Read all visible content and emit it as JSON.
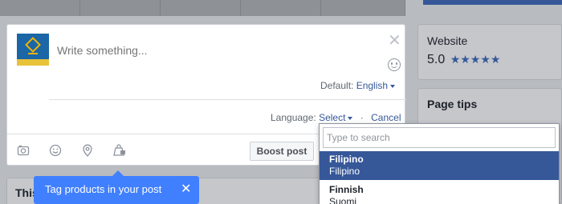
{
  "sidebar": {
    "website_title": "Website",
    "rating_value": "5.0",
    "rating_stars": "★★★★★",
    "page_tips_title": "Page tips"
  },
  "background": {
    "section_title_fragment": "This"
  },
  "composer": {
    "placeholder": "Write something...",
    "close_symbol": "✕",
    "default_label": "Default:",
    "default_value": "English",
    "language_label": "Language:",
    "language_select": "Select",
    "separator": "·",
    "cancel_label": "Cancel",
    "boost_label": "Boost post"
  },
  "footer_icons": [
    "camera-icon",
    "emoji-icon",
    "location-pin-icon",
    "product-tag-icon"
  ],
  "language_dropdown": {
    "search_placeholder": "Type to search",
    "options": [
      {
        "name": "Filipino",
        "native": "Filipino",
        "selected": true
      },
      {
        "name": "Finnish",
        "native": "Suomi",
        "selected": false
      }
    ]
  },
  "tooltip": {
    "text": "Tag products in your post",
    "close_symbol": "✕"
  },
  "colors": {
    "accent": "#365899",
    "tooltip_bg": "#4080ff",
    "overlay": "#b8bbc0"
  }
}
